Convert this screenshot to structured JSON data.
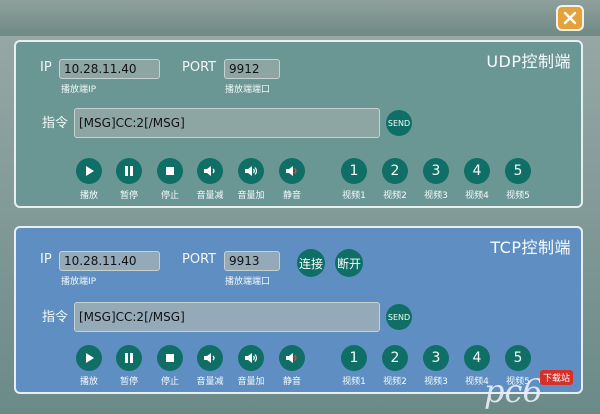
{
  "close_icon": "close-icon",
  "udp": {
    "title": "UDP控制端",
    "ip_label": "IP",
    "ip_value": "10.28.11.40",
    "ip_caption": "播放端IP",
    "port_label": "PORT",
    "port_value": "9912",
    "port_caption": "播放端端口",
    "cmd_label": "指令",
    "cmd_value": "[MSG]CC:2[/MSG]",
    "send_label": "SEND",
    "controls": [
      {
        "icon": "play-icon",
        "label": "播放"
      },
      {
        "icon": "pause-icon",
        "label": "暂停"
      },
      {
        "icon": "stop-icon",
        "label": "停止"
      },
      {
        "icon": "volume-down-icon",
        "label": "音量减"
      },
      {
        "icon": "volume-up-icon",
        "label": "音量加"
      },
      {
        "icon": "mute-icon",
        "label": "静音"
      }
    ],
    "videos": [
      {
        "num": "1",
        "label": "视频1"
      },
      {
        "num": "2",
        "label": "视频2"
      },
      {
        "num": "3",
        "label": "视频3"
      },
      {
        "num": "4",
        "label": "视频4"
      },
      {
        "num": "5",
        "label": "视频5"
      }
    ]
  },
  "tcp": {
    "title": "TCP控制端",
    "ip_label": "IP",
    "ip_value": "10.28.11.40",
    "ip_caption": "播放端IP",
    "port_label": "PORT",
    "port_value": "9913",
    "port_caption": "播放端端口",
    "connect_label": "连接",
    "disconnect_label": "断开",
    "cmd_label": "指令",
    "cmd_value": "[MSG]CC:2[/MSG]",
    "send_label": "SEND",
    "controls": [
      {
        "icon": "play-icon",
        "label": "播放"
      },
      {
        "icon": "pause-icon",
        "label": "暂停"
      },
      {
        "icon": "stop-icon",
        "label": "停止"
      },
      {
        "icon": "volume-down-icon",
        "label": "音量减"
      },
      {
        "icon": "volume-up-icon",
        "label": "音量加"
      },
      {
        "icon": "mute-icon",
        "label": "静音"
      }
    ],
    "videos": [
      {
        "num": "1",
        "label": "视频1"
      },
      {
        "num": "2",
        "label": "视频2"
      },
      {
        "num": "3",
        "label": "视频3"
      },
      {
        "num": "4",
        "label": "视频4"
      },
      {
        "num": "5",
        "label": "视频5"
      }
    ]
  },
  "watermark": {
    "text": "pc6",
    "badge": "下载站"
  }
}
